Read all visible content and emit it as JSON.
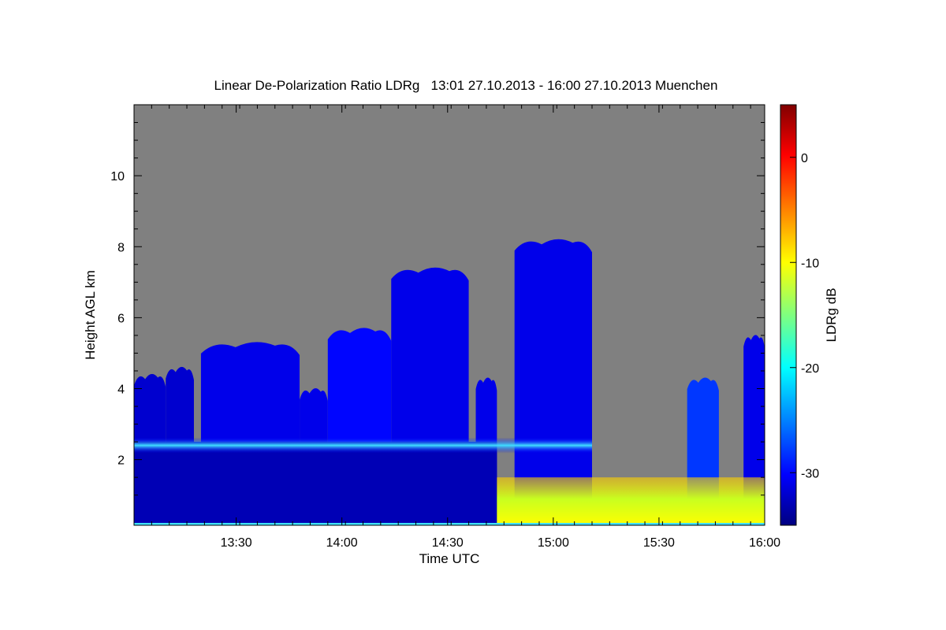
{
  "chart_data": {
    "type": "heatmap",
    "title": "Linear De-Polarization Ratio LDRg   13:01 27.10.2013 - 16:00 27.10.2013 Muenchen",
    "xlabel": "Time UTC",
    "ylabel": "Height AGL km",
    "colorbar_label": "LDRg dB",
    "x_ticks": [
      "13:30",
      "14:00",
      "14:30",
      "15:00",
      "15:30",
      "16:00"
    ],
    "y_ticks": [
      "2",
      "4",
      "6",
      "8",
      "10"
    ],
    "colorbar_ticks": [
      "0",
      "-10",
      "-20",
      "-30"
    ],
    "x_range": [
      "13:01",
      "16:00"
    ],
    "ylim": [
      0.15,
      12.0
    ],
    "colorbar_range": [
      -35,
      5
    ],
    "colorbar_colors": [
      "#000080",
      "#0000ff",
      "#00ffff",
      "#ffff00",
      "#ff0000",
      "#800000"
    ],
    "no_signal_color": "#808080",
    "cloud_columns": [
      {
        "start": "13:01",
        "end": "13:10",
        "top_km": 4.4,
        "ldr_db": -32
      },
      {
        "start": "13:10",
        "end": "13:18",
        "top_km": 4.6,
        "ldr_db": -32
      },
      {
        "start": "13:20",
        "end": "13:48",
        "top_km": 5.3,
        "ldr_db": -31
      },
      {
        "start": "13:48",
        "end": "13:56",
        "top_km": 4.0,
        "ldr_db": -31
      },
      {
        "start": "13:56",
        "end": "14:14",
        "top_km": 5.7,
        "ldr_db": -30
      },
      {
        "start": "14:14",
        "end": "14:36",
        "top_km": 7.4,
        "ldr_db": -31
      },
      {
        "start": "14:38",
        "end": "14:44",
        "top_km": 4.3,
        "ldr_db": -31
      },
      {
        "start": "14:49",
        "end": "15:11",
        "top_km": 8.2,
        "ldr_db": -31
      },
      {
        "start": "15:38",
        "end": "15:47",
        "top_km": 4.3,
        "ldr_db": -28
      },
      {
        "start": "15:54",
        "end": "16:00",
        "top_km": 5.5,
        "ldr_db": -31
      }
    ],
    "melting_layer": {
      "height_km": 2.4,
      "start": "13:01",
      "end": "15:11",
      "ldr_db": -22
    },
    "near_surface_aerosol": {
      "start": "14:44",
      "end": "16:00",
      "top_km": 1.5,
      "ldr_db": -14
    }
  }
}
